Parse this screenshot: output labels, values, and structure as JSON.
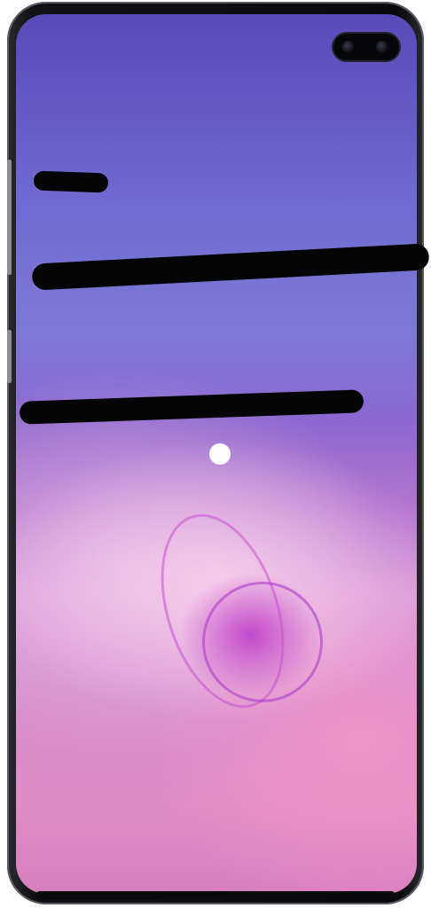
{
  "device": {
    "model_hint": "smartphone-front",
    "wallpaper": "purple-pink-abstract",
    "screen_text": [
      "",
      "",
      ""
    ]
  },
  "colors": {
    "redaction": "#050505",
    "indicator_dot": "#ffffff",
    "frame": "#0a0a0c"
  }
}
